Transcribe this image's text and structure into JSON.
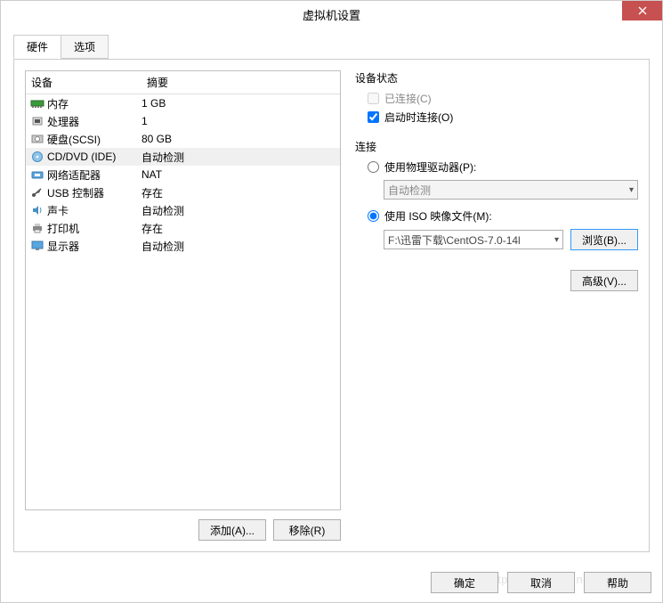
{
  "title": "虚拟机设置",
  "tabs": {
    "hardware": "硬件",
    "options": "选项"
  },
  "listHeaders": {
    "device": "设备",
    "summary": "摘要"
  },
  "devices": [
    {
      "name": "内存",
      "summary": "1 GB",
      "icon": "memory"
    },
    {
      "name": "处理器",
      "summary": "1",
      "icon": "cpu"
    },
    {
      "name": "硬盘(SCSI)",
      "summary": "80 GB",
      "icon": "hdd"
    },
    {
      "name": "CD/DVD (IDE)",
      "summary": "自动检测",
      "icon": "cd",
      "selected": true
    },
    {
      "name": "网络适配器",
      "summary": "NAT",
      "icon": "network"
    },
    {
      "name": "USB 控制器",
      "summary": "存在",
      "icon": "usb"
    },
    {
      "name": "声卡",
      "summary": "自动检测",
      "icon": "sound"
    },
    {
      "name": "打印机",
      "summary": "存在",
      "icon": "printer"
    },
    {
      "name": "显示器",
      "summary": "自动检测",
      "icon": "display"
    }
  ],
  "leftButtons": {
    "add": "添加(A)...",
    "remove": "移除(R)"
  },
  "status": {
    "legend": "设备状态",
    "connected": "已连接(C)",
    "connectAtPowerOn": "启动时连接(O)"
  },
  "connection": {
    "legend": "连接",
    "physical": "使用物理驱动器(P):",
    "physicalDropdown": "自动检测",
    "iso": "使用 ISO 映像文件(M):",
    "isoPath": "F:\\迅雷下载\\CentOS-7.0-14l",
    "browse": "浏览(B)..."
  },
  "advanced": "高级(V)...",
  "dialogButtons": {
    "ok": "确定",
    "cancel": "取消",
    "help": "帮助"
  },
  "watermark": "http://blog.csdn.net/baigoocn"
}
